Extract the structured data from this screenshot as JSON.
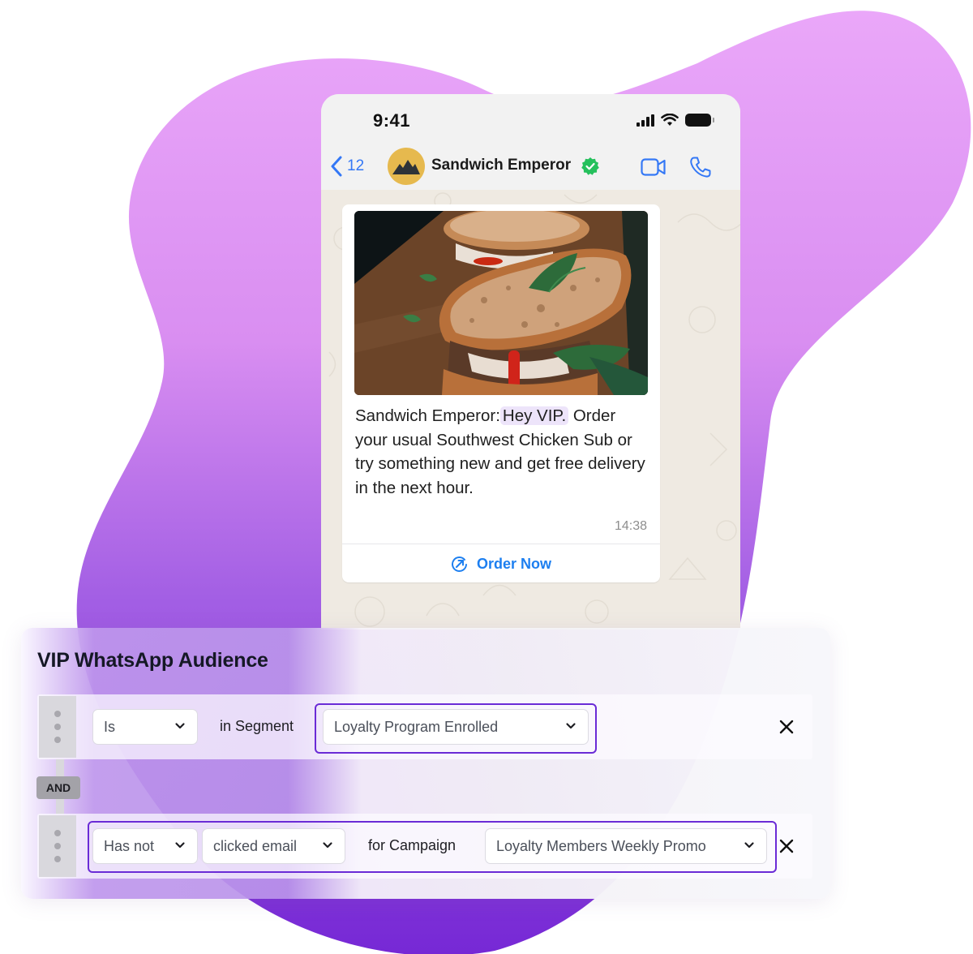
{
  "colors": {
    "blob_top": "#e8a6f7",
    "blob_bottom": "#7a2bd8",
    "whatsapp_blue": "#3478f6",
    "verified_green": "#25c05c",
    "accent_purple": "#6a2bd6",
    "avatar_yellow": "#e6b94e"
  },
  "phone": {
    "status_bar": {
      "time": "9:41",
      "icons": [
        "signal-icon",
        "wifi-icon",
        "battery-icon"
      ]
    },
    "header": {
      "back_count": "12",
      "contact_name": "Sandwich Emperor",
      "verified": true,
      "actions": [
        "video-call-icon",
        "voice-call-icon"
      ]
    },
    "message": {
      "image_alt": "Toasted sandwich with arugula and red pepper",
      "sender_prefix": "Sandwich Emperor:",
      "highlight": "Hey VIP.",
      "body": " Order your usual Southwest Chicken Sub or try something new and get free delivery in the next hour.",
      "time": "14:38",
      "cta_label": "Order Now",
      "cta_icon": "external-link-icon"
    }
  },
  "audience": {
    "title": "VIP WhatsApp Audience",
    "conjunction": "AND",
    "rules": [
      {
        "condition": "Is",
        "label": "in Segment",
        "value": "Loyalty Program Enrolled"
      },
      {
        "condition": "Has not",
        "action": "clicked email",
        "label": "for Campaign",
        "value": "Loyalty Members Weekly Promo"
      }
    ]
  }
}
